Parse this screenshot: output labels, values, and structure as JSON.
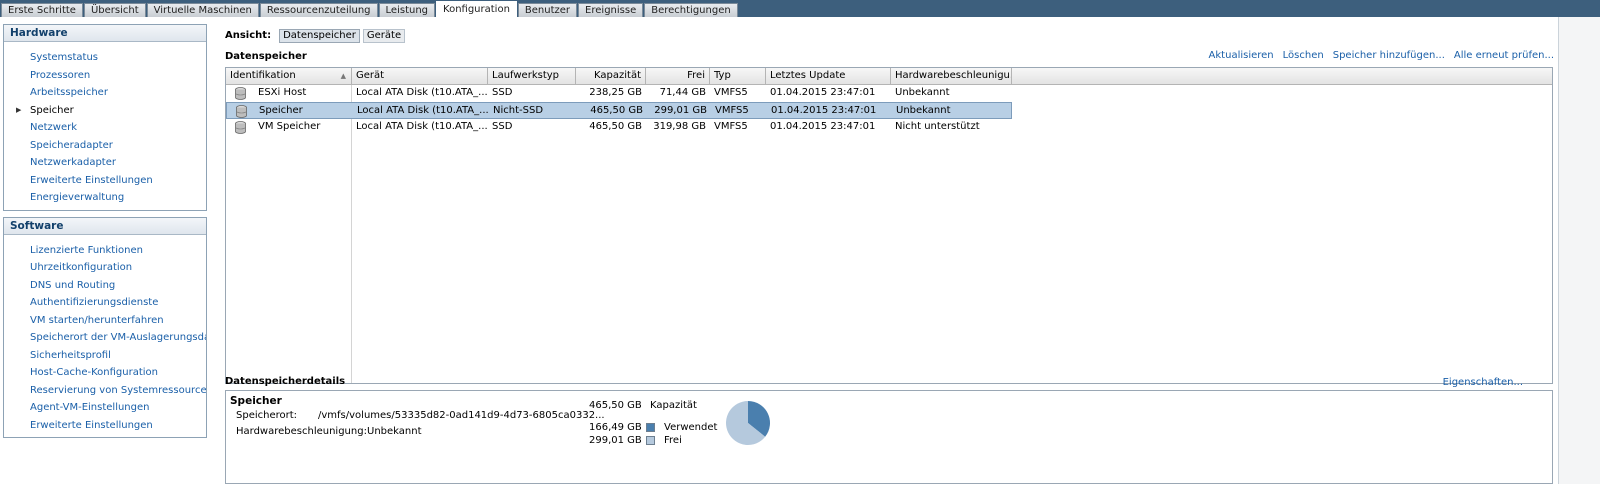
{
  "tabs": [
    "Erste Schritte",
    "Übersicht",
    "Virtuelle Maschinen",
    "Ressourcenzuteilung",
    "Leistung",
    "Konfiguration",
    "Benutzer",
    "Ereignisse",
    "Berechtigungen"
  ],
  "active_tab": "Konfiguration",
  "hardware": {
    "title": "Hardware",
    "items": [
      "Systemstatus",
      "Prozessoren",
      "Arbeitsspeicher",
      "Speicher",
      "Netzwerk",
      "Speicheradapter",
      "Netzwerkadapter",
      "Erweiterte Einstellungen",
      "Energieverwaltung"
    ],
    "current": "Speicher"
  },
  "software": {
    "title": "Software",
    "items": [
      "Lizenzierte Funktionen",
      "Uhrzeitkonfiguration",
      "DNS und Routing",
      "Authentifizierungsdienste",
      "VM starten/herunterfahren",
      "Speicherort der VM-Auslagerungsdatei",
      "Sicherheitsprofil",
      "Host-Cache-Konfiguration",
      "Reservierung von Systemressourcen",
      "Agent-VM-Einstellungen",
      "Erweiterte Einstellungen"
    ]
  },
  "view": {
    "label": "Ansicht:",
    "options": [
      "Datenspeicher",
      "Geräte"
    ],
    "selected": "Datenspeicher"
  },
  "datastores": {
    "title": "Datenspeicher",
    "actions": [
      "Aktualisieren",
      "Löschen",
      "Speicher hinzufügen...",
      "Alle erneut prüfen..."
    ],
    "columns": [
      "Identifikation",
      "Gerät",
      "Laufwerkstyp",
      "Kapazität",
      "Frei",
      "Typ",
      "Letztes Update",
      "Hardwarebeschleunigu..."
    ],
    "rows": [
      [
        "ESXi Host",
        "Local ATA Disk (t10.ATA_...",
        "SSD",
        "238,25 GB",
        "71,44 GB",
        "VMFS5",
        "01.04.2015 23:47:01",
        "Unbekannt"
      ],
      [
        "Speicher",
        "Local ATA Disk (t10.ATA_...",
        "Nicht-SSD",
        "465,50 GB",
        "299,01 GB",
        "VMFS5",
        "01.04.2015 23:47:01",
        "Unbekannt"
      ],
      [
        "VM Speicher",
        "Local ATA Disk (t10.ATA_...",
        "SSD",
        "465,50 GB",
        "319,98 GB",
        "VMFS5",
        "01.04.2015 23:47:01",
        "Nicht unterstützt"
      ]
    ],
    "selected_row": 1
  },
  "details": {
    "title": "Datenspeicherdetails",
    "properties_link": "Eigenschaften...",
    "name": "Speicher",
    "location_label": "Speicherort:",
    "location_value": "/vmfs/volumes/53335d82-0ad141d9-4d73-6805ca0332...",
    "hwaccel_label": "Hardwarebeschleunigung:",
    "hwaccel_value": "Unbekannt",
    "capacity_value": "465,50 GB",
    "capacity_label": "Kapazität",
    "used_value": "166,49 GB",
    "used_label": "Verwendet",
    "free_value": "299,01 GB",
    "free_label": "Frei",
    "used_gb": 166.49,
    "free_gb": 299.01,
    "colors": {
      "used": "#4a7fae",
      "free": "#b5c9dd"
    }
  }
}
